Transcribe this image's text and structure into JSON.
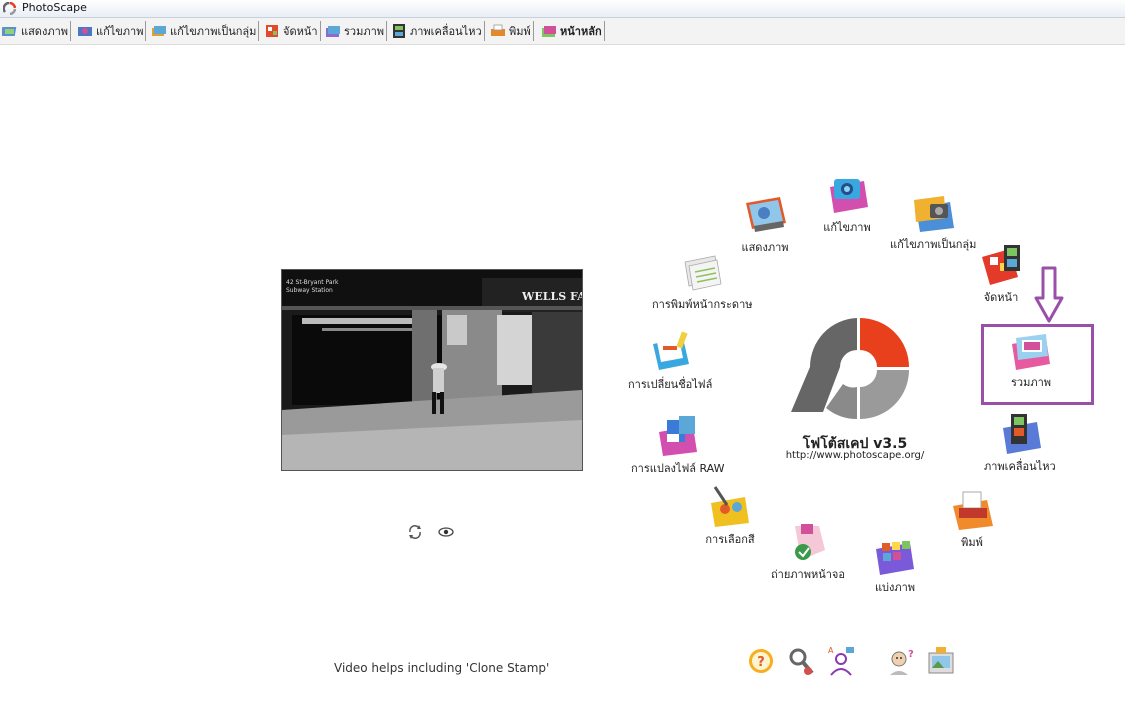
{
  "window": {
    "title": "PhotoScape"
  },
  "tabs": [
    {
      "label": "แสดงภาพ"
    },
    {
      "label": "แก้ไขภาพ"
    },
    {
      "label": "แก้ไขภาพเป็นกลุ่ม"
    },
    {
      "label": "จัดหน้า"
    },
    {
      "label": "รวมภาพ"
    },
    {
      "label": "ภาพเคลื่อนไหว"
    },
    {
      "label": "พิมพ์"
    },
    {
      "label": "หน้าหลัก"
    }
  ],
  "preview": {
    "sign_street": "42 St-Bryant Park",
    "sign_station": "Subway Station",
    "sign_bank": "WELLS FAR"
  },
  "help_text": "Video helps including 'Clone Stamp'",
  "logo": {
    "name": "โฟโต้สเคป v3.5",
    "url": "http://www.photoscape.org/"
  },
  "menu": {
    "viewer": "แสดงภาพ",
    "editor": "แก้ไขภาพ",
    "batch": "แก้ไขภาพเป็นกลุ่ม",
    "page": "จัดหน้า",
    "combine": "รวมภาพ",
    "animated": "ภาพเคลื่อนไหว",
    "print": "พิมพ์",
    "splitter": "แบ่งภาพ",
    "screen_capture": "ถ่ายภาพหน้าจอ",
    "color_picker": "การเลือกสี",
    "raw_converter": "การแปลงไฟล์ RAW",
    "rename": "การเปลี่ยนชื่อไฟล์",
    "paper_print": "การพิมพ์หน้ากระดาษ"
  },
  "colors": {
    "highlight": "#9a4fa8",
    "logo_red": "#e8401c",
    "logo_gray": "#777777"
  }
}
